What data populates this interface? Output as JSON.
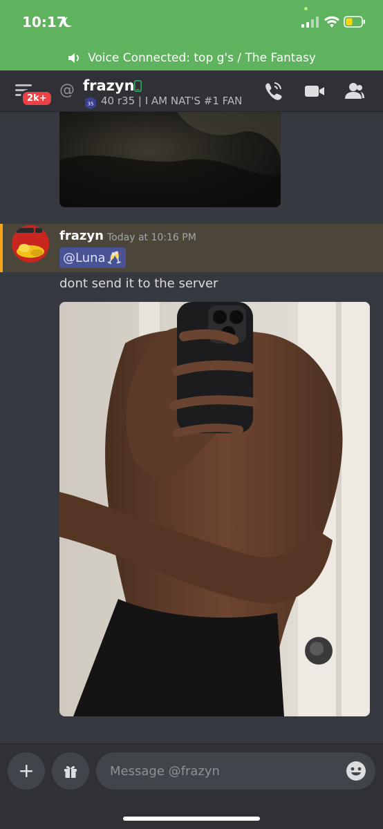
{
  "status_bar": {
    "time": "10:17",
    "icons": [
      "moon-icon",
      "signal-icon",
      "wifi-icon",
      "battery-icon"
    ],
    "accent_color": "#5fb35f"
  },
  "voice_banner": {
    "text": "Voice Connected: top g's / The Fantasy",
    "icon": "speaker-icon"
  },
  "header": {
    "unread_badge": "2k+",
    "at_symbol": "@",
    "name": "frazyn",
    "level_badge": "35",
    "status": "40 r35 | I AM NAT'S #1 FAN",
    "actions": [
      "call-icon",
      "video-icon",
      "members-icon"
    ]
  },
  "message": {
    "author": "frazyn",
    "timestamp": "Today at 10:16 PM",
    "mention": "@Luna",
    "mention_emoji": "🥂",
    "text": "dont send it to the server",
    "highlight_color": "#4b4639",
    "highlight_accent": "#faa61a"
  },
  "composer": {
    "placeholder": "Message @frazyn",
    "buttons": [
      "plus-icon",
      "gift-icon",
      "emoji-icon"
    ]
  }
}
